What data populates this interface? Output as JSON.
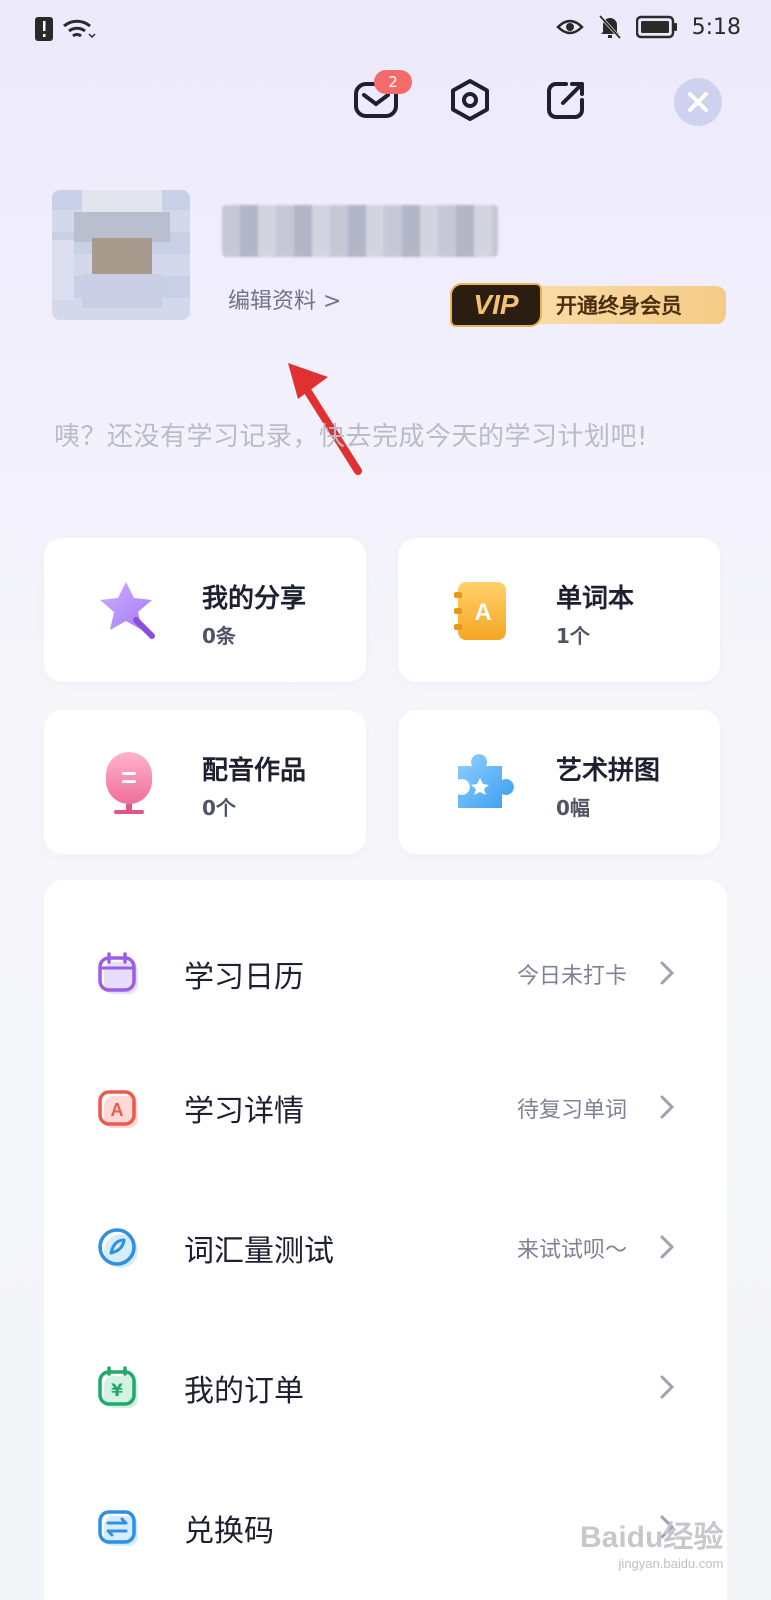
{
  "status_bar": {
    "time": "5:18"
  },
  "header": {
    "message_badge": "2"
  },
  "profile": {
    "edit_profile": "编辑资料 >"
  },
  "vip": {
    "tag": "VIP",
    "label": "开通终身会员"
  },
  "empty_message": "咦？还没有学习记录，快去完成今天的学习计划吧!",
  "cards": [
    {
      "title": "我的分享",
      "value": "0条"
    },
    {
      "title": "单词本",
      "value": "1个"
    },
    {
      "title": "配音作品",
      "value": "0个"
    },
    {
      "title": "艺术拼图",
      "value": "0幅"
    }
  ],
  "menu": [
    {
      "label": "学习日历",
      "sub": "今日未打卡"
    },
    {
      "label": "学习详情",
      "sub": "待复习单词"
    },
    {
      "label": "词汇量测试",
      "sub": "来试试呗～"
    },
    {
      "label": "我的订单",
      "sub": ""
    },
    {
      "label": "兑换码",
      "sub": ""
    }
  ],
  "watermark": {
    "brand": "Baidu经验",
    "url": "jingyan.baidu.com"
  },
  "colors": {
    "vip_gold": "#f3cb85",
    "badge_red": "#f36b6b",
    "arrow_red": "#e03030"
  }
}
